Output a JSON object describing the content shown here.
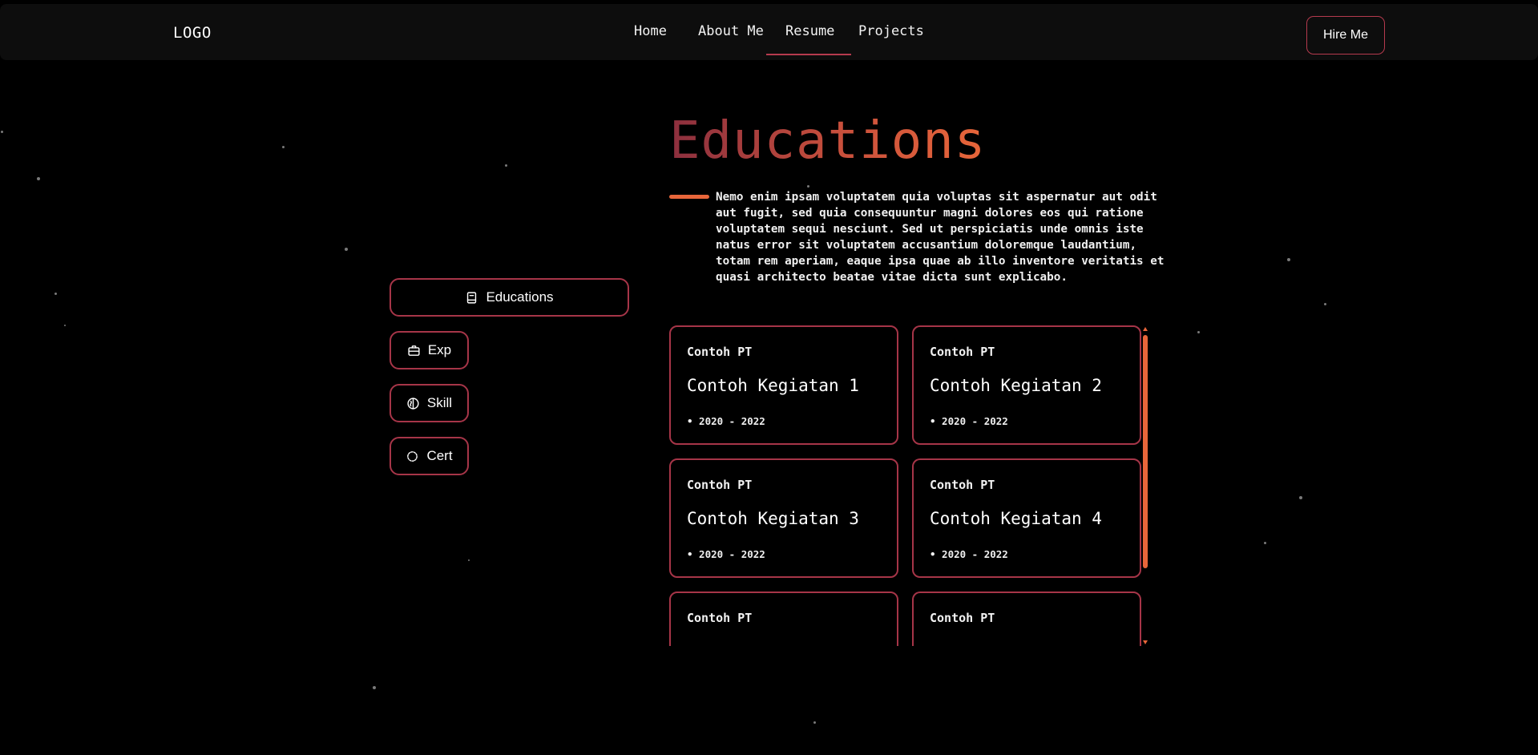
{
  "nav": {
    "logo": "LOGO",
    "links": [
      {
        "label": "Home"
      },
      {
        "label": "About Me"
      },
      {
        "label": "Resume"
      },
      {
        "label": "Projects"
      }
    ],
    "active": "Resume",
    "hire_label": "Hire Me"
  },
  "section": {
    "title": "Educations",
    "description": "Nemo enim ipsam voluptatem quia voluptas sit aspernatur aut odit aut fugit, sed quia consequuntur magni dolores eos qui ratione voluptatem sequi nesciunt. Sed ut perspiciatis unde omnis iste natus error sit voluptatem accusantium doloremque laudantium, totam rem aperiam, eaque ipsa quae ab illo inventore veritatis et quasi architecto beatae vitae dicta sunt explicabo."
  },
  "tabs": [
    {
      "label": "Educations",
      "icon": "book-icon"
    },
    {
      "label": "Exp",
      "icon": "briefcase-icon"
    },
    {
      "label": "Skill",
      "icon": "brain-icon"
    },
    {
      "label": "Cert",
      "icon": "badge-icon"
    }
  ],
  "cards": [
    {
      "company": "Contoh PT",
      "title": "Contoh Kegiatan 1",
      "period": "• 2020 - 2022"
    },
    {
      "company": "Contoh PT",
      "title": "Contoh Kegiatan 2",
      "period": "• 2020 - 2022"
    },
    {
      "company": "Contoh PT",
      "title": "Contoh Kegiatan 3",
      "period": "• 2020 - 2022"
    },
    {
      "company": "Contoh PT",
      "title": "Contoh Kegiatan 4",
      "period": "• 2020 - 2022"
    },
    {
      "company": "Contoh PT",
      "title": "",
      "period": ""
    },
    {
      "company": "Contoh PT",
      "title": "",
      "period": ""
    }
  ],
  "colors": {
    "accent": "#e8663a",
    "border": "#a63548",
    "navbar_bg": "#0d0d0d",
    "background": "#000000"
  }
}
